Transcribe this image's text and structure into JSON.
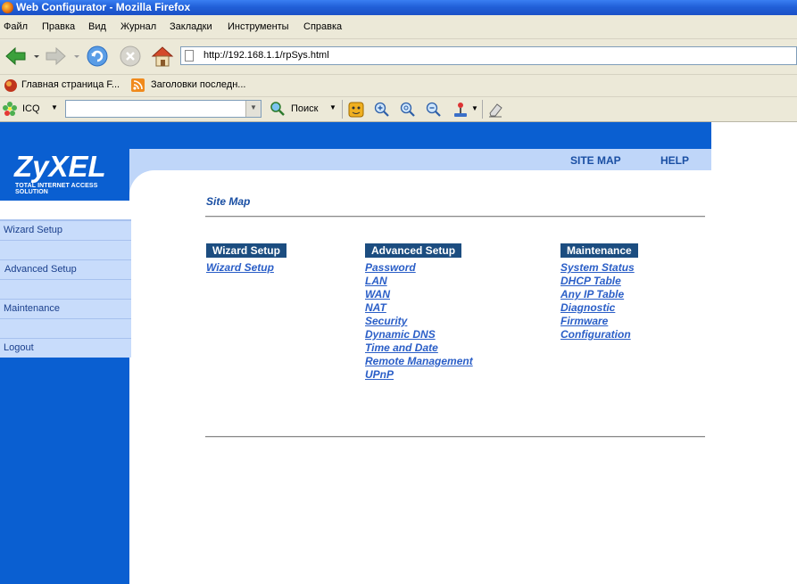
{
  "window": {
    "title": "Web Configurator - Mozilla Firefox"
  },
  "menu": [
    "Файл",
    "Правка",
    "Вид",
    "Журнал",
    "Закладки",
    "Инструменты",
    "Справка"
  ],
  "address": {
    "url": "http://192.168.1.1/rpSys.html"
  },
  "bookmarks": [
    "Главная страница F...",
    "Заголовки последн..."
  ],
  "icq_toolbar": {
    "icq_label": "ICQ",
    "search_label": "Поиск",
    "search_value": ""
  },
  "header": {
    "logo": "ZyXEL",
    "tagline": "TOTAL INTERNET ACCESS SOLUTION",
    "site_map": "SITE MAP",
    "help": "HELP"
  },
  "sidebar": {
    "items": [
      "Wizard Setup",
      "Advanced Setup",
      "Maintenance",
      "Logout"
    ]
  },
  "main": {
    "title": "Site Map",
    "sections": [
      {
        "heading": "Wizard Setup",
        "links": [
          "Wizard Setup"
        ]
      },
      {
        "heading": "Advanced Setup",
        "links": [
          "Password",
          "LAN",
          "WAN",
          "NAT",
          "Security",
          "Dynamic DNS",
          "Time and Date",
          "Remote Management",
          "UPnP"
        ]
      },
      {
        "heading": "Maintenance",
        "links": [
          "System Status",
          "DHCP Table",
          "Any IP Table",
          "Diagnostic",
          "Firmware",
          "Configuration"
        ]
      }
    ]
  },
  "colors": {
    "brand_blue": "#0a5fd1",
    "light_blue": "#bfd6f9",
    "section_bg": "#1c4d80",
    "link": "#2a5ec7"
  }
}
